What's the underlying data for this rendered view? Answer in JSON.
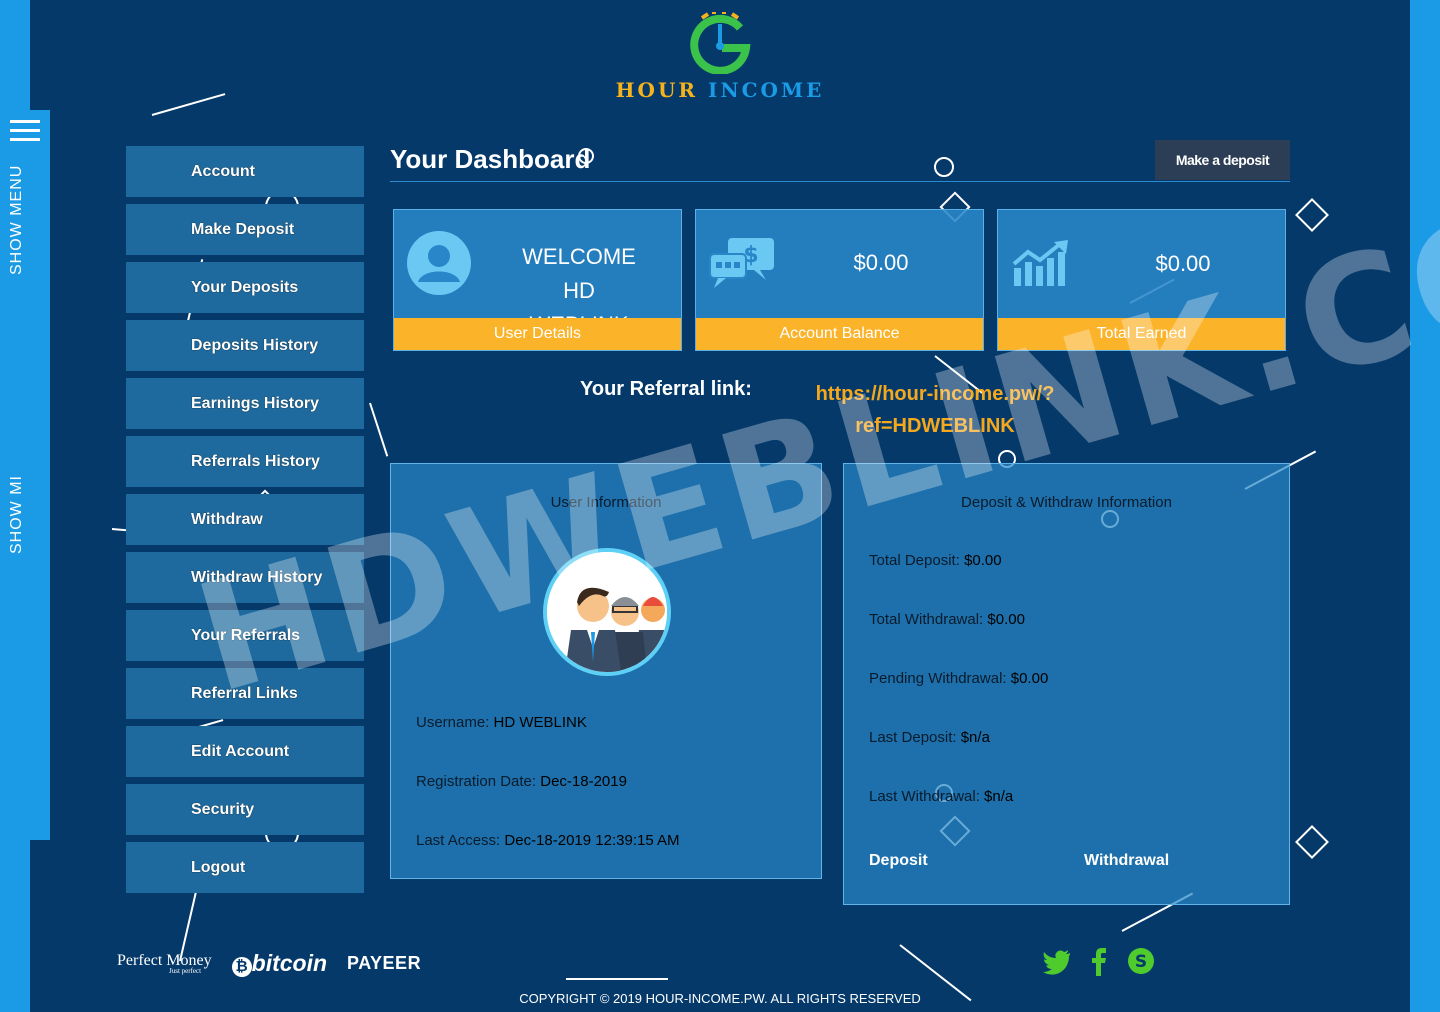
{
  "brand": {
    "word1": "HOUR",
    "word2": "INCOME",
    "logo_letter": "G"
  },
  "side_toggle": {
    "label1": "SHOW MENU",
    "label2": "SHOW MI"
  },
  "sidebar": {
    "items": [
      {
        "label": "Account"
      },
      {
        "label": "Make Deposit"
      },
      {
        "label": "Your Deposits"
      },
      {
        "label": "Deposits History"
      },
      {
        "label": "Earnings History"
      },
      {
        "label": "Referrals History"
      },
      {
        "label": "Withdraw"
      },
      {
        "label": "Withdraw History"
      },
      {
        "label": "Your Referrals"
      },
      {
        "label": "Referral Links"
      },
      {
        "label": "Edit Account"
      },
      {
        "label": "Security"
      },
      {
        "label": "Logout"
      }
    ]
  },
  "header": {
    "title": "Your Dashboard",
    "deposit_button": "Make a deposit"
  },
  "cards": [
    {
      "line1": "WELCOME",
      "line2": "HD WEBLINK",
      "footer": "User Details",
      "icon": "user-icon"
    },
    {
      "value": "$0.00",
      "footer": "Account Balance",
      "icon": "money-chat-icon"
    },
    {
      "value": "$0.00",
      "footer": "Total Earned",
      "icon": "growth-chart-icon"
    }
  ],
  "referral": {
    "label": "Your Referral link:",
    "link_line1": "https://hour-income.pw/?",
    "link_line2": "ref=HDWEBLINK"
  },
  "user_info": {
    "title": "User Information",
    "username_label": "Username:",
    "username": "HD WEBLINK",
    "reg_label": "Registration Date:",
    "reg_date": "Dec-18-2019",
    "access_label": "Last Access:",
    "access": "Dec-18-2019 12:39:15 AM"
  },
  "dw_info": {
    "title": "Deposit & Withdraw Information",
    "total_deposit_label": "Total Deposit:",
    "total_deposit": "$0.00",
    "total_withdrawal_label": "Total Withdrawal:",
    "total_withdrawal": "$0.00",
    "pending_label": "Pending Withdrawal:",
    "pending": "$0.00",
    "last_deposit_label": "Last Deposit:",
    "last_deposit": "$n/a",
    "last_withdrawal_label": "Last Withdrawal:",
    "last_withdrawal": "$n/a",
    "tab_deposit": "Deposit",
    "tab_withdrawal": "Withdrawal"
  },
  "watermark": "HDWEBLINK.COM",
  "payments": {
    "perfect_money": "Perfect Money",
    "perfect_money_tag": "Just perfect",
    "bitcoin": "bitcoin",
    "payeer": "PAYEER"
  },
  "social": [
    "twitter-icon",
    "facebook-icon",
    "skype-icon"
  ],
  "footer": {
    "copyright": "COPYRIGHT © 2019 HOUR-INCOME.PW. ALL RIGHTS RESERVED"
  },
  "colors": {
    "background": "#04396a",
    "accent_blue": "#1b9ae5",
    "accent_orange": "#fbb32a",
    "card_blue": "#2987c9"
  }
}
